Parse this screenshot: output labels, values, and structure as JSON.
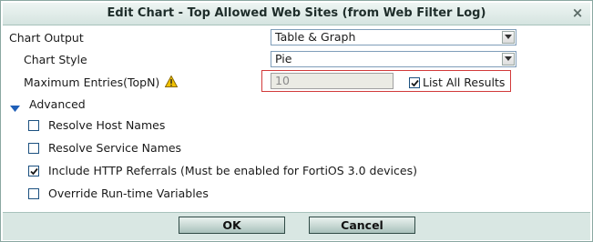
{
  "dialog": {
    "title": "Edit Chart - Top Allowed Web Sites (from Web Filter Log)",
    "close_glyph": "×"
  },
  "form": {
    "chart_output": {
      "label": "Chart Output",
      "value": "Table & Graph"
    },
    "chart_style": {
      "label": "Chart Style",
      "value": "Pie"
    },
    "max_entries": {
      "label": "Maximum Entries(TopN)",
      "value": "10"
    },
    "list_all": {
      "label": "List All Results",
      "checked": true
    },
    "advanced": {
      "label": "Advanced",
      "expanded": true
    },
    "options": [
      {
        "label": "Resolve Host Names",
        "checked": false
      },
      {
        "label": "Resolve Service Names",
        "checked": false
      },
      {
        "label": "Include HTTP Referrals (Must be enabled for FortiOS 3.0 devices)",
        "checked": true
      },
      {
        "label": "Override Run-time Variables",
        "checked": false
      }
    ]
  },
  "buttons": {
    "ok": "OK",
    "cancel": "Cancel"
  },
  "icons": {
    "warning": "warning-icon",
    "close": "close-icon",
    "expand": "triangle-down-icon",
    "dropdown": "chevron-down-icon"
  },
  "colors": {
    "accent_border": "#d23a3a",
    "checkbox_border": "#1c5180",
    "footer_bg": "#d9e7e3"
  }
}
